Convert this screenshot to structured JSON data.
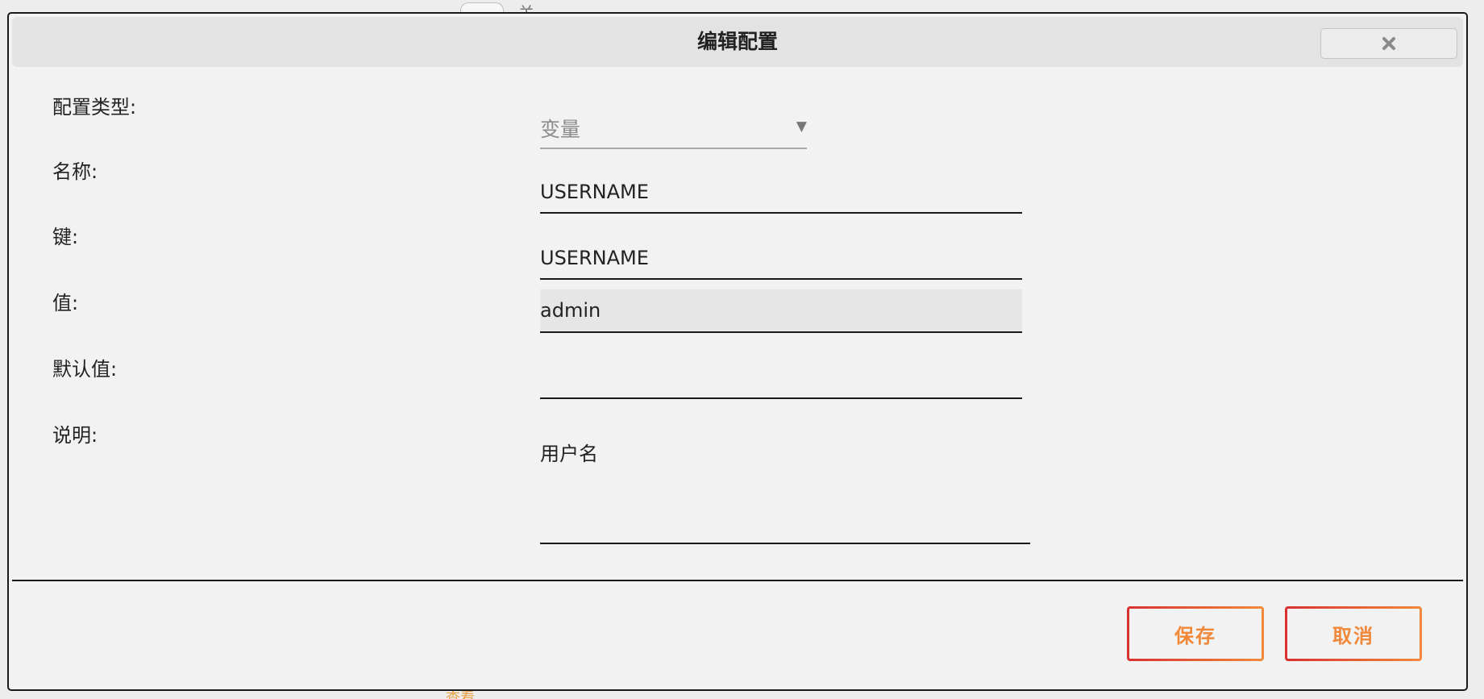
{
  "background": {
    "toggle_label": "关",
    "bottom_text": "查看"
  },
  "dialog": {
    "title": "编辑配置",
    "close_icon": "close-icon"
  },
  "form": {
    "type_label": "配置类型:",
    "type_value": "变量",
    "name_label": "名称:",
    "name_value": "USERNAME",
    "key_label": "键:",
    "key_value": "USERNAME",
    "value_label": "值:",
    "value_value": "admin",
    "default_label": "默认值:",
    "default_value": "",
    "desc_label": "说明:",
    "desc_value": "用户名"
  },
  "footer": {
    "save_label": "保存",
    "cancel_label": "取消"
  },
  "colors": {
    "accent_text": "#f0883a",
    "accent_border_start": "#d93030",
    "accent_border_end": "#f08a3c"
  }
}
